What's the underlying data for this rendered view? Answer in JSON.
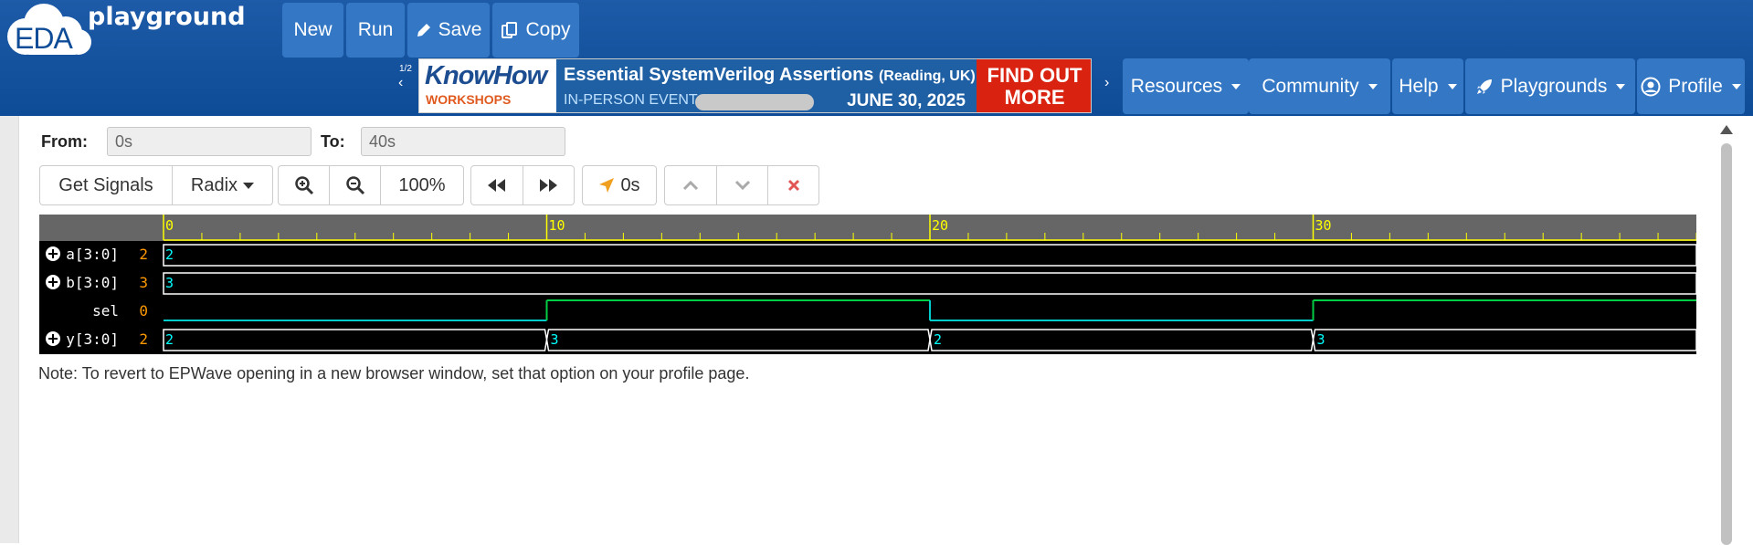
{
  "app": {
    "logo_text": "EDA",
    "brand_text": "playground"
  },
  "toolbar": {
    "new_label": "New",
    "run_label": "Run",
    "save_label": "Save",
    "copy_label": "Copy"
  },
  "ad": {
    "counter": "1/2",
    "prev_icon": "chevron-left-icon",
    "next_icon": "chevron-right-icon",
    "brand_top": "KnowHow",
    "brand_bottom": "WORKSHOPS",
    "title": "Essential SystemVerilog Assertions",
    "title_location": "(Reading, UK)",
    "subtitle": "IN-PERSON EVENT",
    "date": "JUNE 30, 2025",
    "cta_line1": "FIND OUT",
    "cta_line2": "MORE"
  },
  "menu": {
    "resources": "Resources",
    "community": "Community",
    "help": "Help",
    "playgrounds": "Playgrounds",
    "profile": "Profile"
  },
  "wave_controls": {
    "from_label": "From:",
    "from_value": "0s",
    "to_label": "To:",
    "to_value": "40s",
    "get_signals": "Get Signals",
    "radix": "Radix",
    "zoom_level": "100%",
    "cursor_time": "0s"
  },
  "waveform": {
    "time_start": 0,
    "time_end": 40,
    "major_ticks": [
      0,
      10,
      20,
      30
    ],
    "major_tick_labels": [
      "0",
      "10",
      "20",
      "30"
    ],
    "signals": [
      {
        "name": "a[3:0]",
        "expandable": true,
        "cursor_value": "2",
        "type": "bus",
        "segments": [
          {
            "start": 0,
            "end": 40,
            "value": "2"
          }
        ]
      },
      {
        "name": "b[3:0]",
        "expandable": true,
        "cursor_value": "3",
        "type": "bus",
        "segments": [
          {
            "start": 0,
            "end": 40,
            "value": "3"
          }
        ]
      },
      {
        "name": "sel",
        "expandable": false,
        "cursor_value": "0",
        "type": "bit",
        "segments": [
          {
            "start": 0,
            "end": 10,
            "value": 0
          },
          {
            "start": 10,
            "end": 20,
            "value": 1
          },
          {
            "start": 20,
            "end": 30,
            "value": 0
          },
          {
            "start": 30,
            "end": 40,
            "value": 1
          }
        ]
      },
      {
        "name": "y[3:0]",
        "expandable": true,
        "cursor_value": "2",
        "type": "bus",
        "segments": [
          {
            "start": 0,
            "end": 10,
            "value": "2"
          },
          {
            "start": 10,
            "end": 20,
            "value": "3"
          },
          {
            "start": 20,
            "end": 30,
            "value": "2"
          },
          {
            "start": 30,
            "end": 40,
            "value": "3"
          }
        ]
      }
    ],
    "colors": {
      "background": "#000000",
      "ruler": "#666666",
      "ruler_marks": "#ffff00",
      "bus_line": "#ffffff",
      "value_text": "#00ffff",
      "cursor_value": "#ff9900",
      "bit_high": "#00cc44",
      "bit_low": "#00cccc",
      "signal_name": "#ffffff"
    }
  },
  "note": "Note: To revert to EPWave opening in a new browser window, set that option on your profile page."
}
